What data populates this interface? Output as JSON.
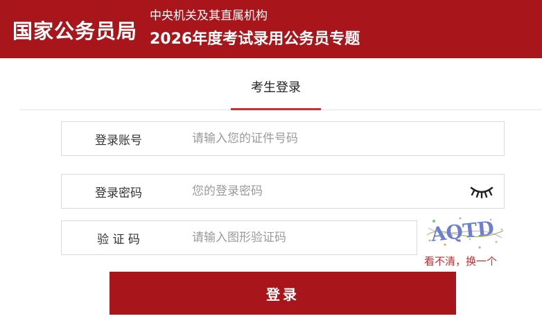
{
  "header": {
    "brand": "国家公务员局",
    "subtitle_line1": "中央机关及其直属机构",
    "subtitle_line2": "2026年度考试录用公务员专题"
  },
  "tabs": [
    {
      "label": "考生登录",
      "active": true
    }
  ],
  "form": {
    "account": {
      "label": "登录账号",
      "placeholder": "请输入您的证件号码",
      "value": ""
    },
    "password": {
      "label": "登录密码",
      "placeholder": "您的登录密码",
      "value": "",
      "toggle_icon": "eye-closed-icon"
    },
    "captcha": {
      "label": "验 证 码",
      "placeholder": "请输入图形验证码",
      "value": "",
      "image_text": "AQTD",
      "refresh_label": "看不清，换一个"
    },
    "submit_label": "登录"
  },
  "colors": {
    "brand_red": "#a8161b",
    "accent_red": "#d12a2f",
    "border": "#d9d9d9",
    "placeholder": "#9a9a9a"
  }
}
